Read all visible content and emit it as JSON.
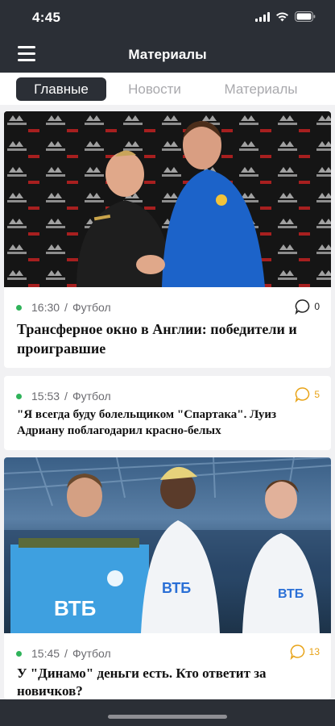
{
  "status_bar": {
    "time": "4:45"
  },
  "nav": {
    "title": "Материалы",
    "menu_icon": "hamburger-icon"
  },
  "tabs": [
    {
      "label": "Главные",
      "active": true
    },
    {
      "label": "Новости",
      "active": false
    },
    {
      "label": "Материалы",
      "active": false
    }
  ],
  "articles": [
    {
      "time": "16:30",
      "category": "Футбол",
      "comments": "0",
      "comment_color": "#222222",
      "title": "Трансферное окно в Англии: победители и проигравшие",
      "has_image": true,
      "image_icon": "press-conference-photo"
    },
    {
      "time": "15:53",
      "category": "Футбол",
      "comments": "5",
      "comment_color": "#e8a317",
      "title": "\"Я всегда буду болельщиком \"Спартака\". Луиз Адриану поблагодарил красно-белых",
      "has_image": false
    },
    {
      "time": "15:45",
      "category": "Футбол",
      "comments": "13",
      "comment_color": "#e8a317",
      "title": "У \"Динамо\" деньги есть. Кто ответит за новичков?",
      "has_image": true,
      "image_icon": "stadium-players-photo"
    }
  ],
  "meta_separator": "/",
  "colors": {
    "dark": "#2b2f36",
    "live_dot": "#2fb35a",
    "accent": "#e8a317",
    "background": "#f1f1f3"
  }
}
